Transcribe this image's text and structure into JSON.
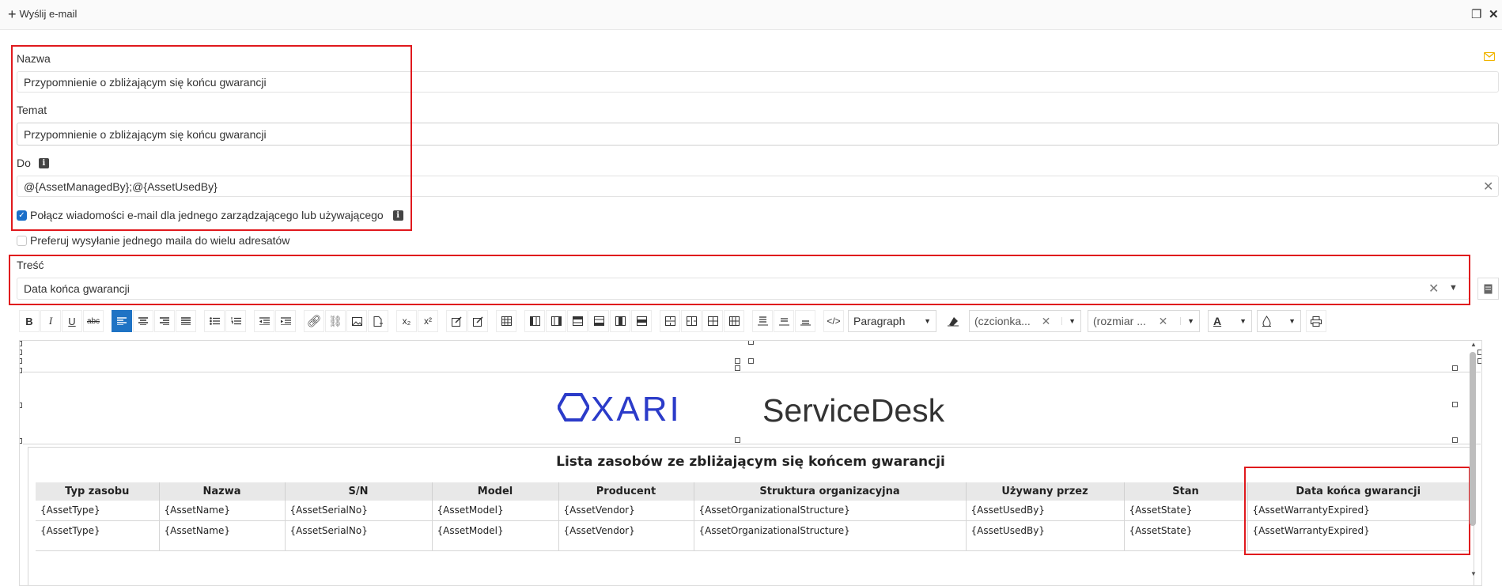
{
  "topbar": {
    "add_label": "Wyślij e-mail"
  },
  "form": {
    "name_label": "Nazwa",
    "name_value": "Przypomnienie o zbliżającym się końcu gwarancji",
    "subject_label": "Temat",
    "subject_value": "Przypomnienie o zbliżającym się końcu gwarancji",
    "to_label": "Do",
    "to_value": "@{AssetManagedBy};@{AssetUsedBy}",
    "merge_label": "Połącz wiadomości e-mail dla jednego zarządzającego lub używającego",
    "merge_checked": true,
    "prefer_label": "Preferuj wysyłanie jednego maila do wielu adresatów",
    "prefer_checked": false,
    "body_label": "Treść",
    "body_template_value": "Data końca gwarancji"
  },
  "toolbar": {
    "paragraph_select": "Paragraph",
    "font_select": "(czcionka...",
    "size_select": "(rozmiar ..."
  },
  "editor": {
    "logo_text": "OXARI",
    "logo_product": "ServiceDesk",
    "table_title": "Lista zasobów ze zbliżającym się końcem gwarancji",
    "columns": [
      "Typ zasobu",
      "Nazwa",
      "S/N",
      "Model",
      "Producent",
      "Struktura organizacyjna",
      "Używany przez",
      "Stan",
      "Data końca gwarancji"
    ],
    "rows": [
      [
        "{AssetType}",
        "{AssetName}",
        "{AssetSerialNo}",
        "{AssetModel}",
        "{AssetVendor}",
        "{AssetOrganizationalStructure}",
        "{AssetUsedBy}",
        "{AssetState}",
        "{AssetWarrantyExpired}"
      ],
      [
        "{AssetType}",
        "{AssetName}",
        "{AssetSerialNo}",
        "{AssetModel}",
        "{AssetVendor}",
        "{AssetOrganizationalStructure}",
        "{AssetUsedBy}",
        "{AssetState}",
        "{AssetWarrantyExpired}"
      ]
    ]
  },
  "colors": {
    "highlight": "#e0191d",
    "accent": "#1f73c4",
    "logo": "#2b3bc9",
    "mail_icon": "#f0b400"
  }
}
